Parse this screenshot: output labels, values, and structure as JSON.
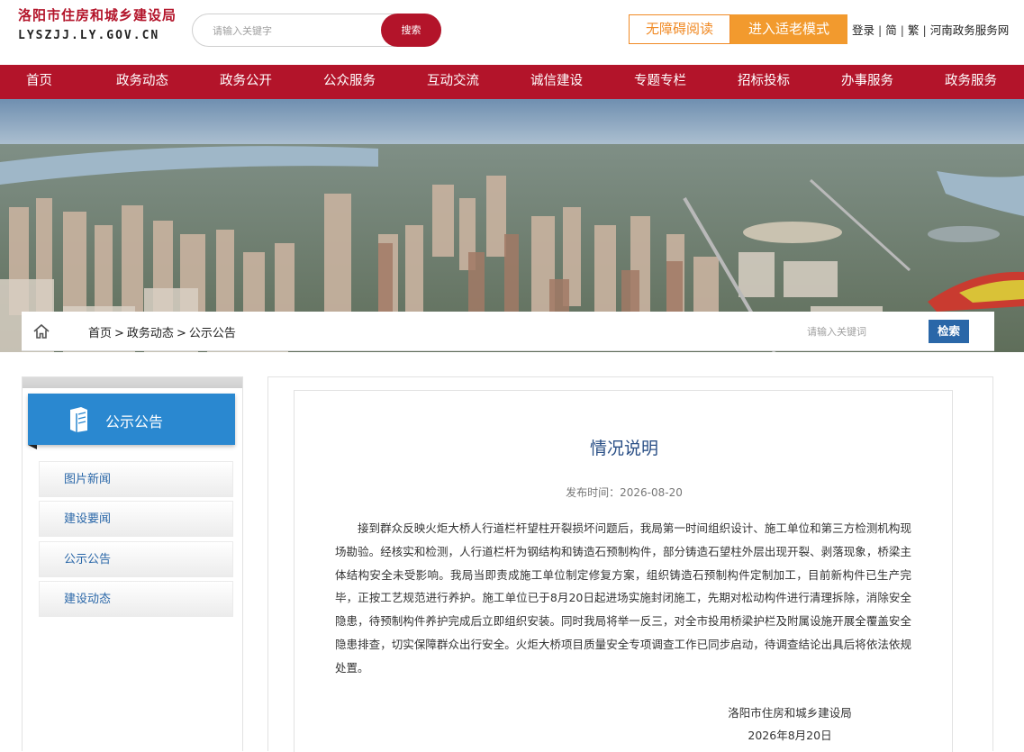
{
  "header": {
    "logo_cn": "洛阳市住房和城乡建设局",
    "logo_en": "LYSZJJ.LY.GOV.CN",
    "search_placeholder": "请输入关键字",
    "search_button": "搜索",
    "accessible_reading": "无障碍阅读",
    "elder_mode": "进入适老模式",
    "links": {
      "login": "登录",
      "simplified": "简",
      "traditional": "繁",
      "henan_portal": "河南政务服务网"
    },
    "separator": "|"
  },
  "nav": [
    "首页",
    "政务动态",
    "政务公开",
    "公众服务",
    "互动交流",
    "诚信建设",
    "专题专栏",
    "招标投标",
    "办事服务",
    "政务服务"
  ],
  "breadcrumb": {
    "items": [
      "首页",
      "政务动态",
      "公示公告"
    ],
    "separator": ">"
  },
  "site_search": {
    "placeholder": "请输入关键词",
    "button": "检索"
  },
  "sidebar": {
    "title": "公示公告",
    "items": [
      "图片新闻",
      "建设要闻",
      "公示公告",
      "建设动态"
    ]
  },
  "article": {
    "title": "情况说明",
    "date_label": "发布时间：2026-08-20",
    "body": "接到群众反映火炬大桥人行道栏杆望柱开裂损坏问题后，我局第一时间组织设计、施工单位和第三方检测机构现场勘验。经核实和检测，人行道栏杆为钢结构和铸造石预制构件，部分铸造石望柱外层出现开裂、剥落现象，桥梁主体结构安全未受影响。我局当即责成施工单位制定修复方案，组织铸造石预制构件定制加工，目前新构件已生产完毕，正按工艺规范进行养护。施工单位已于8月20日起进场实施封闭施工，先期对松动构件进行清理拆除，消除安全隐患，待预制构件养护完成后立即组织安装。同时我局将举一反三，对全市投用桥梁护栏及附属设施开展全覆盖安全隐患排查，切实保障群众出行安全。火炬大桥项目质量安全专项调查工作已同步启动，待调查结论出具后将依法依规处置。",
    "signature_org": "洛阳市住房和城乡建设局",
    "signature_date": "2026年8月20日"
  },
  "colors": {
    "brand_red": "#b3142a",
    "accent_orange": "#f08a25",
    "sidebar_blue": "#2a88d0",
    "link_blue": "#2a67a8"
  }
}
